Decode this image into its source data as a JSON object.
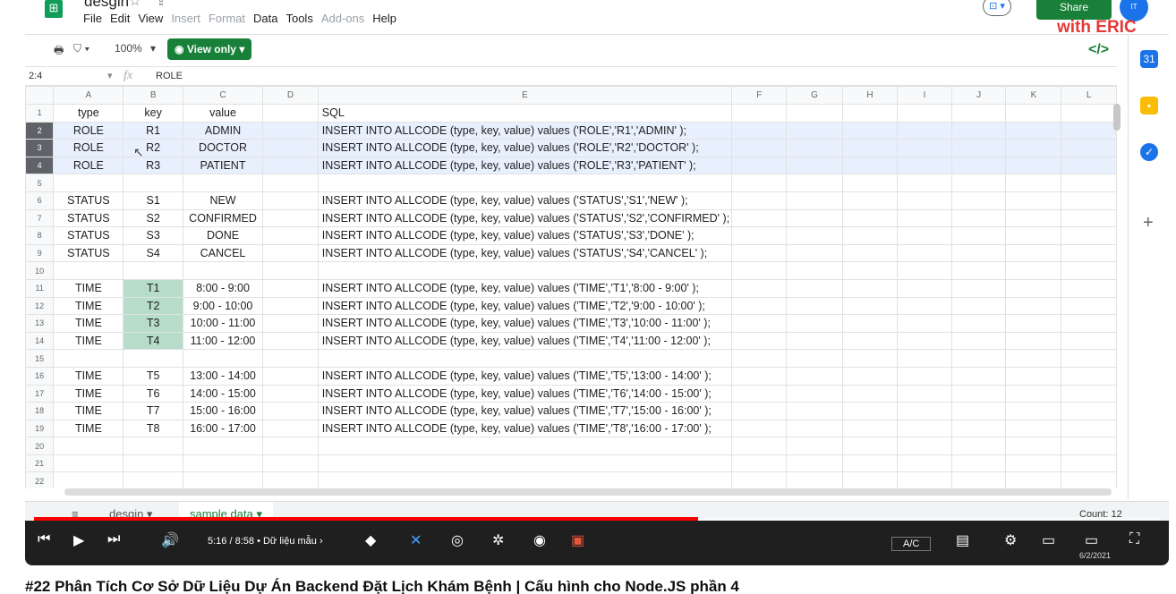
{
  "app": {
    "doc_title": "desgin",
    "menu": [
      "File",
      "Edit",
      "View",
      "Insert",
      "Format",
      "Data",
      "Tools",
      "Add-ons",
      "Help"
    ],
    "share_label": "Share",
    "brand": "with ERIC"
  },
  "toolbar": {
    "zoom": "100%",
    "view_only_label": "View only"
  },
  "formula_bar": {
    "cell_ref": "2:4",
    "fx": "fx",
    "content": "ROLE"
  },
  "columns": [
    "A",
    "B",
    "C",
    "D",
    "E",
    "F",
    "G",
    "H",
    "I",
    "J",
    "K",
    "L"
  ],
  "rows": [
    {
      "n": "1",
      "a": "type",
      "b": "key",
      "c": "value",
      "e": "SQL"
    },
    {
      "n": "2",
      "a": "ROLE",
      "b": "R1",
      "c": "ADMIN",
      "e": "INSERT INTO ALLCODE (type, key, value) values ('ROLE','R1','ADMIN' );"
    },
    {
      "n": "3",
      "a": "ROLE",
      "b": "R2",
      "c": "DOCTOR",
      "e": "INSERT INTO ALLCODE (type, key, value) values ('ROLE','R2','DOCTOR' );"
    },
    {
      "n": "4",
      "a": "ROLE",
      "b": "R3",
      "c": "PATIENT",
      "e": "INSERT INTO ALLCODE (type, key, value) values ('ROLE','R3','PATIENT' );"
    },
    {
      "n": "5",
      "a": "",
      "b": "",
      "c": "",
      "e": ""
    },
    {
      "n": "6",
      "a": "STATUS",
      "b": "S1",
      "c": "NEW",
      "e": "INSERT INTO ALLCODE (type, key, value) values ('STATUS','S1','NEW' );"
    },
    {
      "n": "7",
      "a": "STATUS",
      "b": "S2",
      "c": "CONFIRMED",
      "e": "INSERT INTO ALLCODE (type, key, value) values ('STATUS','S2','CONFIRMED' );"
    },
    {
      "n": "8",
      "a": "STATUS",
      "b": "S3",
      "c": "DONE",
      "e": "INSERT INTO ALLCODE (type, key, value) values ('STATUS','S3','DONE' );"
    },
    {
      "n": "9",
      "a": "STATUS",
      "b": "S4",
      "c": "CANCEL",
      "e": "INSERT INTO ALLCODE (type, key, value) values ('STATUS','S4','CANCEL' );"
    },
    {
      "n": "10",
      "a": "",
      "b": "",
      "c": "",
      "e": ""
    },
    {
      "n": "11",
      "a": "TIME",
      "b": "T1",
      "c": "8:00 - 9:00",
      "e": "INSERT INTO ALLCODE (type, key, value) values ('TIME','T1','8:00 - 9:00' );"
    },
    {
      "n": "12",
      "a": "TIME",
      "b": "T2",
      "c": "9:00 - 10:00",
      "e": "INSERT INTO ALLCODE (type, key, value) values ('TIME','T2','9:00 - 10:00' );"
    },
    {
      "n": "13",
      "a": "TIME",
      "b": "T3",
      "c": "10:00 - 11:00",
      "e": "INSERT INTO ALLCODE (type, key, value) values ('TIME','T3','10:00 - 11:00' );"
    },
    {
      "n": "14",
      "a": "TIME",
      "b": "T4",
      "c": "11:00 - 12:00",
      "e": "INSERT INTO ALLCODE (type, key, value) values ('TIME','T4','11:00 - 12:00' );"
    },
    {
      "n": "15",
      "a": "",
      "b": "",
      "c": "",
      "e": ""
    },
    {
      "n": "16",
      "a": "TIME",
      "b": "T5",
      "c": "13:00 - 14:00",
      "e": "INSERT INTO ALLCODE (type, key, value) values ('TIME','T5','13:00 - 14:00' );"
    },
    {
      "n": "17",
      "a": "TIME",
      "b": "T6",
      "c": "14:00 - 15:00",
      "e": "INSERT INTO ALLCODE (type, key, value) values ('TIME','T6','14:00 - 15:00' );"
    },
    {
      "n": "18",
      "a": "TIME",
      "b": "T7",
      "c": "15:00 - 16:00",
      "e": "INSERT INTO ALLCODE (type, key, value) values ('TIME','T7','15:00 - 16:00' );"
    },
    {
      "n": "19",
      "a": "TIME",
      "b": "T8",
      "c": "16:00 - 17:00",
      "e": "INSERT INTO ALLCODE (type, key, value) values ('TIME','T8','16:00 - 17:00' );"
    },
    {
      "n": "20",
      "a": "",
      "b": "",
      "c": "",
      "e": ""
    },
    {
      "n": "21",
      "a": "",
      "b": "",
      "c": "",
      "e": ""
    },
    {
      "n": "22",
      "a": "",
      "b": "",
      "c": "",
      "e": ""
    }
  ],
  "sheets": {
    "tab1": "desgin",
    "tab2": "sample data",
    "count": "Count: 12"
  },
  "video": {
    "time": "5:16 / 8:58",
    "chapter": "• Dữ liệu mẫu",
    "cc": "A/C",
    "date": "6/2/2021",
    "progress": 0.59,
    "title": "#22 Phân Tích Cơ Sở Dữ Liệu Dự Án Backend Đặt Lịch Khám Bệnh | Cấu hình cho Node.JS phần 4"
  },
  "colors": {
    "accent": "#188038",
    "selection": "#e8f0fe",
    "highlight": "#b7dcc9",
    "progress": "#ff0000"
  }
}
